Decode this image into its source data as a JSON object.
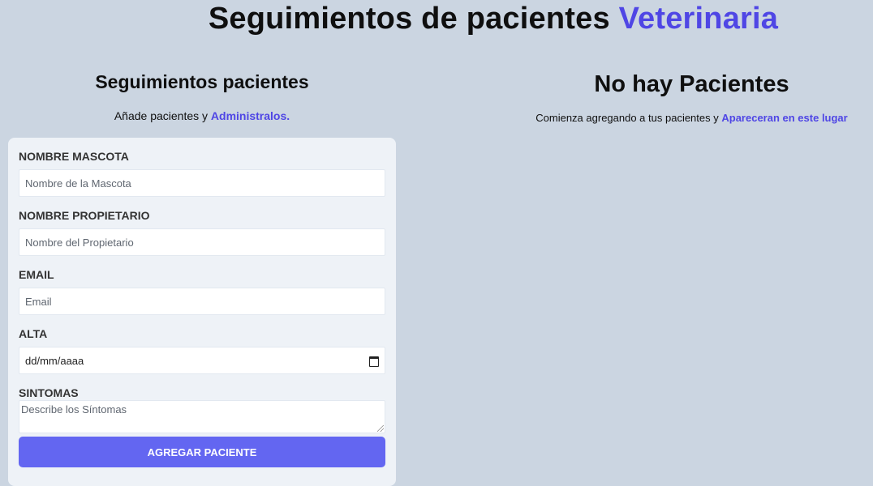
{
  "header": {
    "title_prefix": "Seguimientos de pacientes",
    "title_accent": "Veterinaria"
  },
  "form_section": {
    "title": "Seguimientos pacientes",
    "subtitle_prefix": "Añade pacientes y",
    "subtitle_accent": "Administralos."
  },
  "form": {
    "pet_name": {
      "label": "Nombre Mascota",
      "placeholder": "Nombre de la Mascota",
      "value": ""
    },
    "owner_name": {
      "label": "Nombre Propietario",
      "placeholder": "Nombre del Propietario",
      "value": ""
    },
    "email": {
      "label": "Email",
      "placeholder": "Email",
      "value": ""
    },
    "discharge": {
      "label": "Alta",
      "placeholder": "dd/mm/aaaa",
      "icon": "calendar-icon"
    },
    "symptoms": {
      "label": "Sintomas",
      "placeholder": "Describe los Síntomas"
    },
    "submit_label": "Agregar Paciente"
  },
  "patients_section": {
    "title": "No hay Pacientes",
    "subtitle_prefix": "Comienza agregando a tus pacientes y",
    "subtitle_accent": "Apareceran en este lugar"
  },
  "colors": {
    "background": "#cbd5e1",
    "accent": "#4f46e5",
    "button": "#6366f1",
    "card": "#eef2f7"
  }
}
